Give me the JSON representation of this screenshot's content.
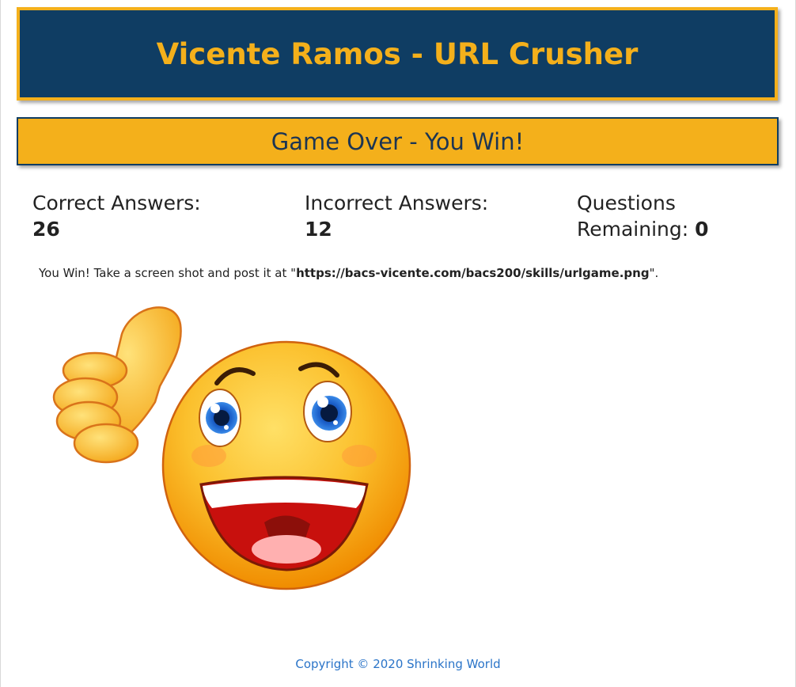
{
  "header": {
    "title": "Vicente Ramos - URL Crusher"
  },
  "status": {
    "heading": "Game Over - You Win!"
  },
  "stats": {
    "correct": {
      "label": "Correct Answers:",
      "value": "26"
    },
    "incorrect": {
      "label": "Incorrect Answers:",
      "value": "12"
    },
    "remaining": {
      "label_line1": "Questions",
      "label_line2": "Remaining:",
      "value": "0"
    }
  },
  "message": {
    "prefix": "You Win! Take a screen shot and post it at \"",
    "url": "https://bacs-vicente.com/bacs200/skills/urlgame.png",
    "suffix": "\"."
  },
  "image": {
    "icon": "thumbs-up-smiley-icon"
  },
  "footer": {
    "copyright": "Copyright © 2020 Shrinking World"
  },
  "colors": {
    "navy": "#0f3d63",
    "gold": "#f4b01b",
    "link": "#2a74c8"
  }
}
